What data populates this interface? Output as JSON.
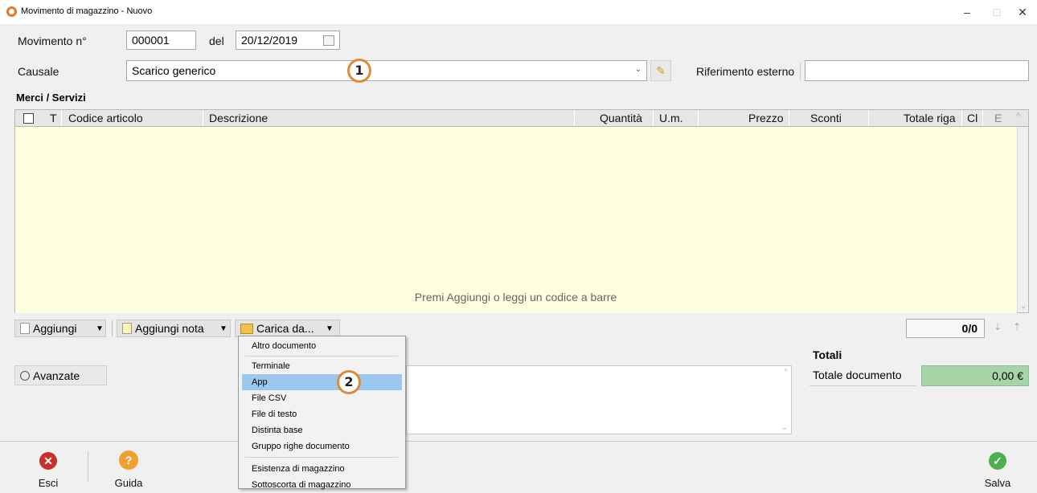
{
  "window": {
    "title": "Movimento di magazzino - Nuovo",
    "minimize": "–",
    "maximize": "□",
    "close": "✕"
  },
  "form": {
    "movement_label": "Movimento n°",
    "movement_value": "000001",
    "date_label": "del",
    "date_value": "20/12/2019",
    "causale_label": "Causale",
    "causale_value": "Scarico generico",
    "ref_label": "Riferimento esterno",
    "ref_value": ""
  },
  "section_title": "Merci / Servizi",
  "grid": {
    "columns": [
      "T",
      "Codice articolo",
      "Descrizione",
      "Quantità",
      "U.m.",
      "Prezzo",
      "Sconti",
      "Totale riga",
      "Cl",
      "E"
    ],
    "empty_text": "Premi Aggiungi o leggi un codice a barre"
  },
  "toolbar": {
    "add_label": "Aggiungi",
    "add_note_label": "Aggiungi nota",
    "load_from_label": "Carica da...",
    "pager": "0/0"
  },
  "menu": {
    "items": [
      "Altro documento",
      "Terminale",
      "App",
      "File CSV",
      "File di testo",
      "Distinta base",
      "Gruppo righe documento",
      "Esistenza di magazzino",
      "Sottoscorta di magazzino"
    ]
  },
  "callouts": [
    "1",
    "2"
  ],
  "advanced_label": "Avanzate",
  "totals": {
    "header": "Totali",
    "doc_label": "Totale documento",
    "doc_value": "0,00 €"
  },
  "bottom": {
    "exit_label": "Esci",
    "help_label": "Guida",
    "save_label": "Salva"
  },
  "colors": {
    "grid_bg": "#ffffe0",
    "menu_selected": "#9cc8ee",
    "callout": "#dd8a3a",
    "total_bg": "#a8d5a8"
  }
}
